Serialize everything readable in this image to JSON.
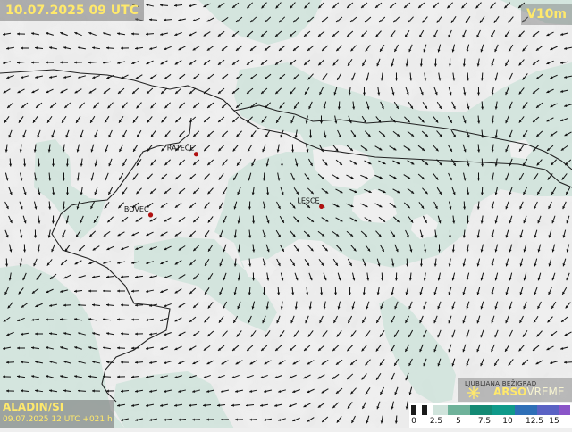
{
  "header": {
    "valid_time": "10.07.2025 09 UTC",
    "variable": "V10m"
  },
  "model": {
    "name": "ALADIN/SI",
    "run": "09.07.2025 12 UTC +021 h"
  },
  "brand": {
    "city": "LJUBLJANA BEŽIGRAD",
    "logo_bold": "ARSO",
    "logo_light": "VREME"
  },
  "legend": {
    "labels": [
      "0",
      "2.5",
      "5",
      "7.5",
      "10",
      "12.5",
      "15"
    ],
    "colors": [
      "#1a1a1a",
      "#ffffff",
      "#1a1a1a",
      "#ffffff",
      "#cfe3db",
      "#6fb29a",
      "#148a74",
      "#0f9a8a",
      "#2e6fb7",
      "#5a62c4",
      "#8a55c8"
    ]
  },
  "places": [
    {
      "name": "RATEČE",
      "lon": 13.72,
      "lat": 46.497
    },
    {
      "name": "BOVEC",
      "lon": 13.553,
      "lat": 46.338
    },
    {
      "name": "LESCE",
      "lon": 14.18,
      "lat": 46.36
    }
  ],
  "colors": {
    "calm_fill": "#efefef",
    "wind_fill": "#cfe3db",
    "arrow": "#111111",
    "place_dot": "#b01010",
    "border": "#222222"
  },
  "icons": [
    "wind-arrow-icon",
    "arso-logo-icon"
  ]
}
